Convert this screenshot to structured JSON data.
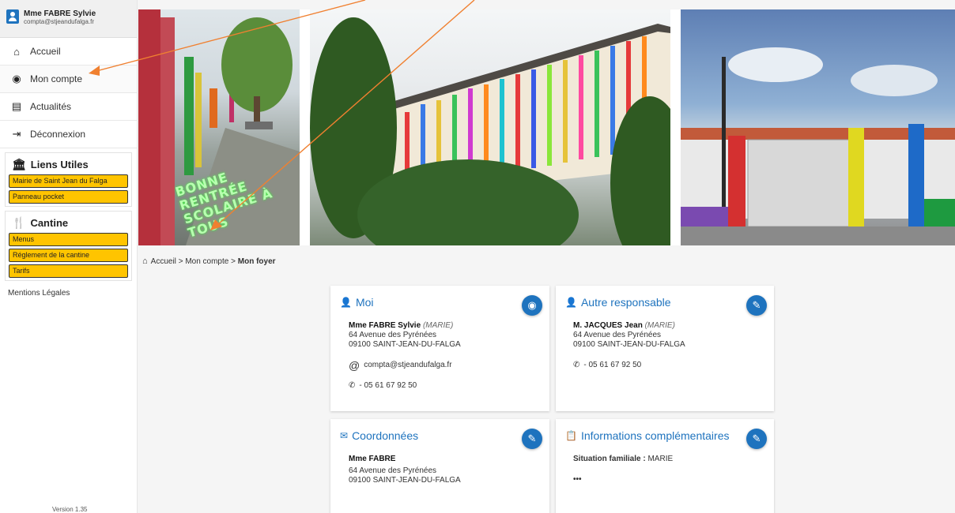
{
  "user": {
    "name": "Mme FABRE Sylvie",
    "email": "compta@stjeandufalga.fr"
  },
  "nav": [
    {
      "label": "Accueil",
      "icon": "home-icon"
    },
    {
      "label": "Mon compte",
      "icon": "account-icon"
    },
    {
      "label": "Actualités",
      "icon": "news-icon"
    },
    {
      "label": "Déconnexion",
      "icon": "logout-icon"
    }
  ],
  "liens": {
    "title": "Liens Utiles",
    "items": [
      "Mairie de Saint Jean du Falga",
      "Panneau pocket"
    ]
  },
  "cantine": {
    "title": "Cantine",
    "items": [
      "Menus",
      "Réglement de la cantine",
      "Tarifs"
    ]
  },
  "mentions": "Mentions Légales",
  "version": "Version 1.35",
  "banner": {
    "text_line1": "BONNE RENTRÉE",
    "text_line2": "SCOLAIRE À TOUS"
  },
  "breadcrumb": {
    "home": "Accueil",
    "sep": ">",
    "account": "Mon compte",
    "current": "Mon foyer"
  },
  "cards": {
    "moi": {
      "title": "Moi",
      "name": "Mme FABRE Sylvie",
      "status": "(MARIE)",
      "address1": "64 Avenue des Pyrénées",
      "address2": "09100 SAINT-JEAN-DU-FALGA",
      "email": "compta@stjeandufalga.fr",
      "phone": "- 05 61 67 92 50"
    },
    "autre": {
      "title": "Autre responsable",
      "name": "M. JACQUES Jean",
      "status": "(MARIE)",
      "address1": "64 Avenue des Pyrénées",
      "address2": "09100 SAINT-JEAN-DU-FALGA",
      "phone": "- 05 61 67 92 50"
    },
    "coord": {
      "title": "Coordonnées",
      "name": "Mme FABRE",
      "address1": "64 Avenue des Pyrénées",
      "address2": "09100 SAINT-JEAN-DU-FALGA"
    },
    "infos": {
      "title": "Informations complémentaires",
      "label": "Situation familiale :",
      "value": " MARIE",
      "more": "•••"
    }
  },
  "colors": {
    "accent": "#1e73be",
    "link_bg": "#ffc400",
    "annotation": "#f08030"
  }
}
